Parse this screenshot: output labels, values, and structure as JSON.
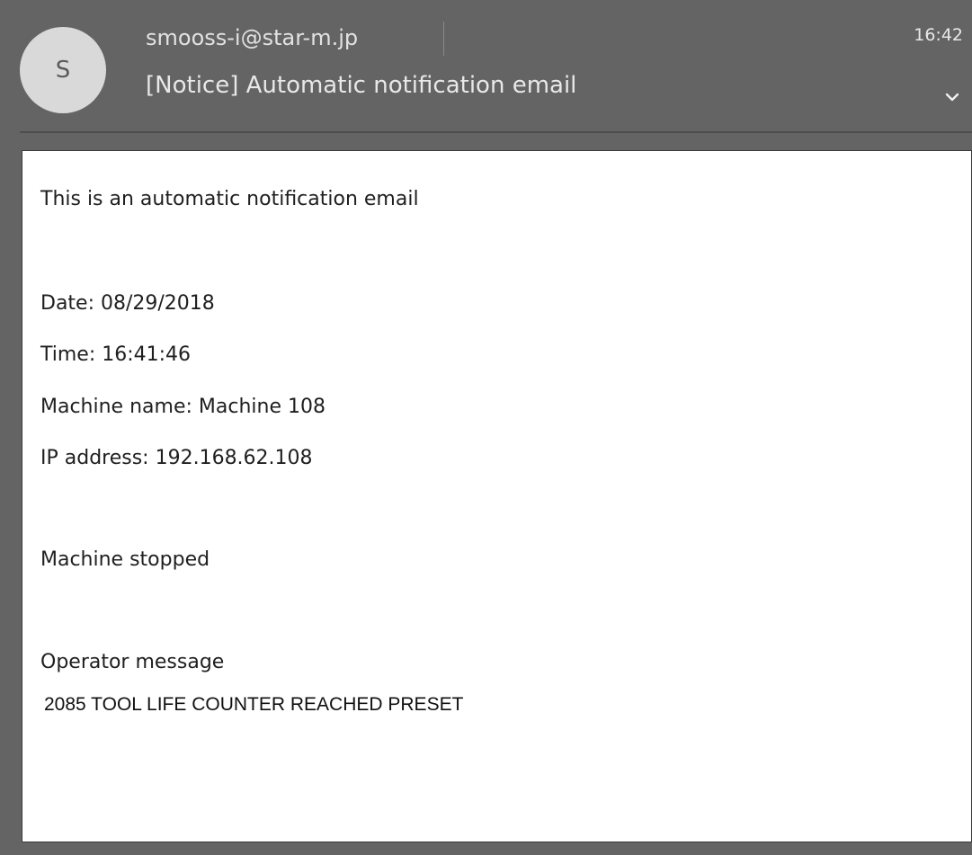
{
  "header": {
    "avatar_letter": "S",
    "sender": "smooss-i@star-m.jp",
    "time": "16:42",
    "subject": "[Notice] Automatic notification email"
  },
  "body": {
    "intro": "This is an automatic notification email",
    "date": "Date: 08/29/2018",
    "time": "Time: 16:41:46",
    "machine_name": "Machine name: Machine 108",
    "ip_address": "IP address: 192.168.62.108",
    "status": "Machine stopped",
    "operator_label": "Operator message",
    "operator_message": "2085 TOOL LIFE COUNTER REACHED PRESET"
  },
  "icons": {
    "expand": "chevron-down-icon"
  }
}
